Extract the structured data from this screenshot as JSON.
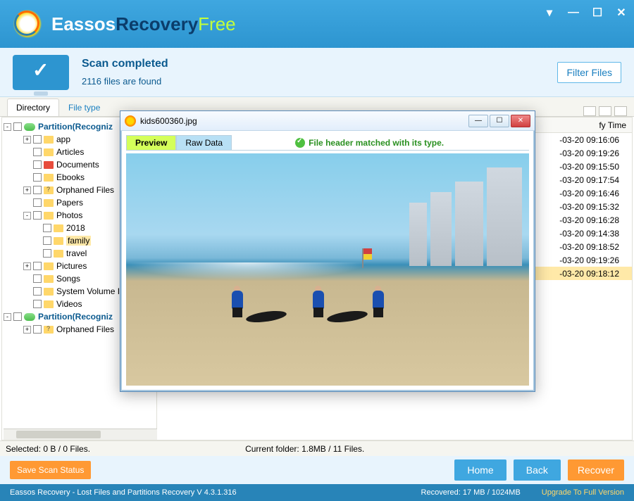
{
  "app": {
    "title_part1": "Eassos",
    "title_part2": "Recovery",
    "title_part3": "Free"
  },
  "status": {
    "title": "Scan completed",
    "subtitle": "2116 files are found",
    "filter_btn": "Filter Files"
  },
  "tabs": {
    "directory": "Directory",
    "filetype": "File type"
  },
  "tree": [
    {
      "indent": 0,
      "exp": "-",
      "icon": "disk",
      "label": "Partition(Recogniz",
      "cls": "partition"
    },
    {
      "indent": 2,
      "exp": "+",
      "icon": "folder",
      "label": "app"
    },
    {
      "indent": 2,
      "exp": "",
      "icon": "folder",
      "label": "Articles"
    },
    {
      "indent": 2,
      "exp": "",
      "icon": "bin",
      "label": "Documents"
    },
    {
      "indent": 2,
      "exp": "",
      "icon": "folder",
      "label": "Ebooks"
    },
    {
      "indent": 2,
      "exp": "+",
      "icon": "question",
      "label": "Orphaned Files"
    },
    {
      "indent": 2,
      "exp": "",
      "icon": "folder",
      "label": "Papers"
    },
    {
      "indent": 2,
      "exp": "-",
      "icon": "folder",
      "label": "Photos"
    },
    {
      "indent": 3,
      "exp": "",
      "icon": "folder",
      "label": "2018"
    },
    {
      "indent": 3,
      "exp": "",
      "icon": "folder",
      "label": "family",
      "selected": true
    },
    {
      "indent": 3,
      "exp": "",
      "icon": "folder",
      "label": "travel"
    },
    {
      "indent": 2,
      "exp": "+",
      "icon": "folder",
      "label": "Pictures"
    },
    {
      "indent": 2,
      "exp": "",
      "icon": "folder",
      "label": "Songs"
    },
    {
      "indent": 2,
      "exp": "",
      "icon": "folder",
      "label": "System Volume In"
    },
    {
      "indent": 2,
      "exp": "",
      "icon": "folder",
      "label": "Videos"
    },
    {
      "indent": 0,
      "exp": "-",
      "icon": "disk",
      "label": "Partition(Recogniz",
      "cls": "partition"
    },
    {
      "indent": 2,
      "exp": "+",
      "icon": "question",
      "label": "Orphaned Files"
    }
  ],
  "file_header": "fy Time",
  "file_times": [
    "-03-20 09:16:06",
    "-03-20 09:19:26",
    "-03-20 09:15:50",
    "-03-20 09:17:54",
    "-03-20 09:16:46",
    "-03-20 09:15:32",
    "-03-20 09:16:28",
    "-03-20 09:14:38",
    "-03-20 09:18:52",
    "-03-20 09:19:26",
    "-03-20 09:18:12"
  ],
  "info": {
    "selected": "Selected: 0 B / 0 Files.",
    "current": "Current folder:  1.8MB / 11 Files."
  },
  "footer": {
    "save": "Save Scan Status",
    "home": "Home",
    "back": "Back",
    "recover": "Recover"
  },
  "statusline": {
    "product": "Eassos Recovery - Lost Files and Partitions Recovery  V 4.3.1.316",
    "recovered": "Recovered: 17 MB / 1024MB",
    "upgrade": "Upgrade To Full Version"
  },
  "preview": {
    "filename": "kids600360.jpg",
    "tab_preview": "Preview",
    "tab_raw": "Raw Data",
    "status": "File header matched with its type."
  }
}
